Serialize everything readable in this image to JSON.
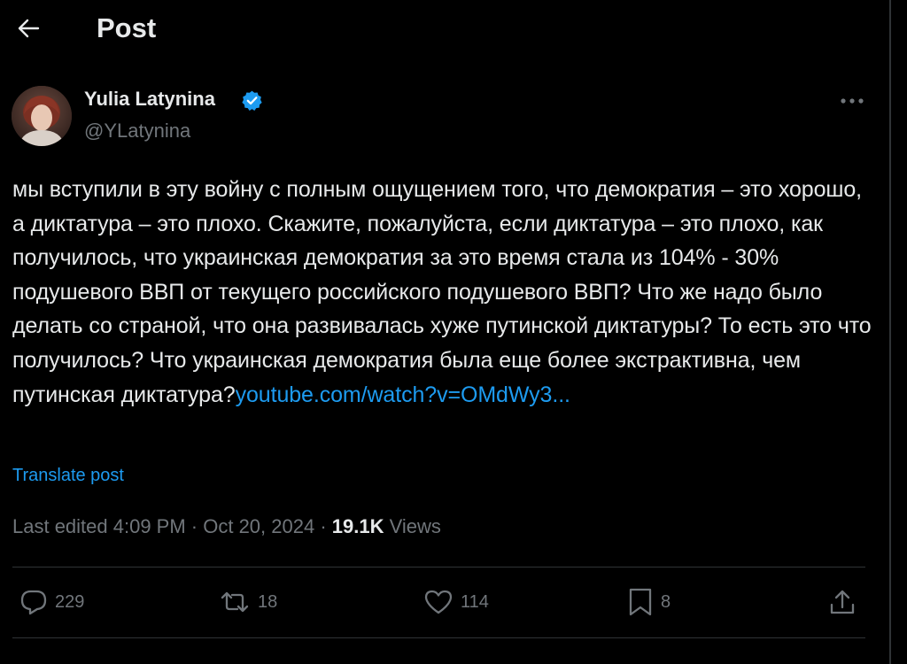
{
  "header": {
    "title": "Post",
    "back_icon": "arrow-left-icon"
  },
  "author": {
    "name": "Yulia Latynina",
    "handle": "@YLatynina",
    "verified": true,
    "verified_color": "#1d9bf0"
  },
  "post": {
    "text": "мы вступили в эту войну с полным ощущением того, что демократия – это хорошо, а диктатура – это плохо. Скажите, пожалуйста, если диктатура – это плохо, как получилось, что украинская демократия за это время стала из 104% - 30% подушевого ВВП от текущего российского подушевого ВВП? Что же надо было делать со страной, что она развивалась хуже путинской диктатуры? То есть это что получилось? Что украинская демократия была еще более экстрактивна, чем путинская диктатура?",
    "link": "youtube.com/watch?v=OMdWy3...",
    "translate_label": "Translate post"
  },
  "meta": {
    "edited": "Last edited 4:09 PM · Oct 20, 2024 ·",
    "views_count": "19.1K",
    "views_label": "Views"
  },
  "actions": {
    "replies": "229",
    "reposts": "18",
    "likes": "114",
    "bookmarks": "8"
  },
  "colors": {
    "background": "#000000",
    "text": "#e7e9ea",
    "secondary": "#71767b",
    "accent": "#1d9bf0",
    "divider": "#2f3336"
  }
}
